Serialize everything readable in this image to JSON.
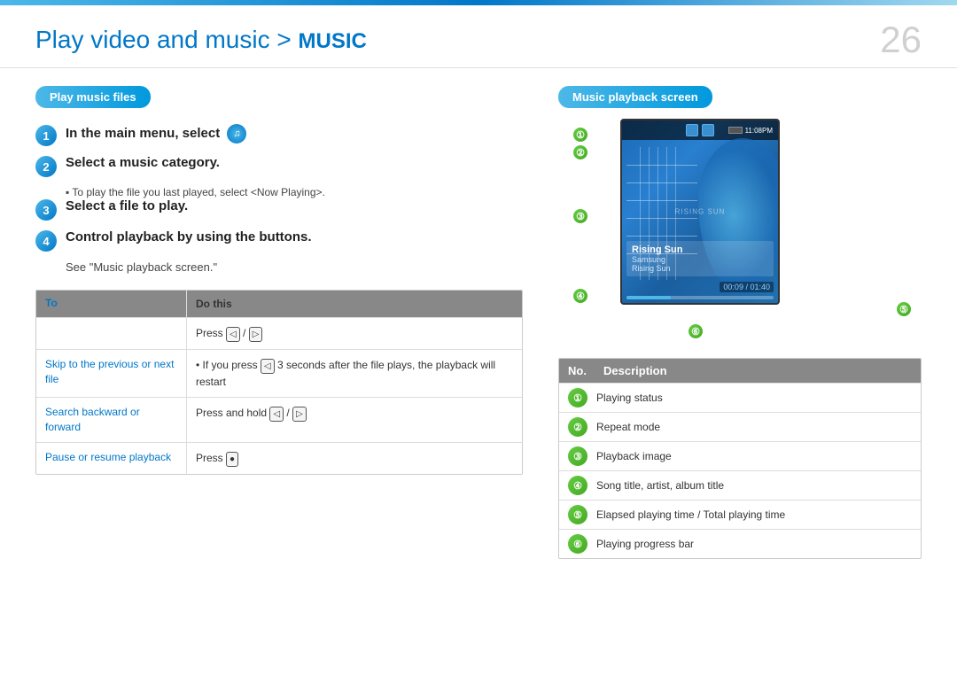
{
  "header": {
    "title_prefix": "Play video and music > ",
    "title_highlight": "MUSIC",
    "page_number": "26"
  },
  "left": {
    "section_badge": "Play music files",
    "steps": [
      {
        "number": "1",
        "text": "In the main menu, select",
        "has_icon": true
      },
      {
        "number": "2",
        "text": "Select a music category.",
        "sub": "To play the file you last played, select <Now Playing>."
      },
      {
        "number": "3",
        "text": "Select a file to play."
      },
      {
        "number": "4",
        "text": "Control playback by using the buttons.",
        "sub_plain": "See \"Music playback screen.\""
      }
    ],
    "table": {
      "header": {
        "col1": "To",
        "col2": "Do this"
      },
      "rows": [
        {
          "to": "",
          "do": "Press [◁] / [▷]"
        },
        {
          "to": "Skip to the previous or next file",
          "do_lines": [
            "• If you press [◁] 3 seconds after the file plays, the playback will restart"
          ]
        },
        {
          "to": "Search backward or forward",
          "do": "Press and hold [◁] / [▷]"
        },
        {
          "to": "Pause or resume playback",
          "do": "Press [●]"
        }
      ]
    }
  },
  "right": {
    "section_badge": "Music playback screen",
    "callouts": [
      "①",
      "②",
      "③",
      "④",
      "⑤",
      "⑥"
    ],
    "screen": {
      "time": "11:08PM",
      "song_title": "Rising Sun",
      "artist": "Samsung",
      "album": "Rising Sun",
      "elapsed": "00:09",
      "total": "01:40"
    },
    "description": {
      "header_no": "No.",
      "header_desc": "Description",
      "items": [
        {
          "num": "1",
          "text": "Playing status"
        },
        {
          "num": "2",
          "text": "Repeat mode"
        },
        {
          "num": "3",
          "text": "Playback image"
        },
        {
          "num": "4",
          "text": "Song title, artist, album title"
        },
        {
          "num": "5",
          "text": "Elapsed playing time / Total playing time"
        },
        {
          "num": "6",
          "text": "Playing progress bar"
        }
      ]
    }
  }
}
